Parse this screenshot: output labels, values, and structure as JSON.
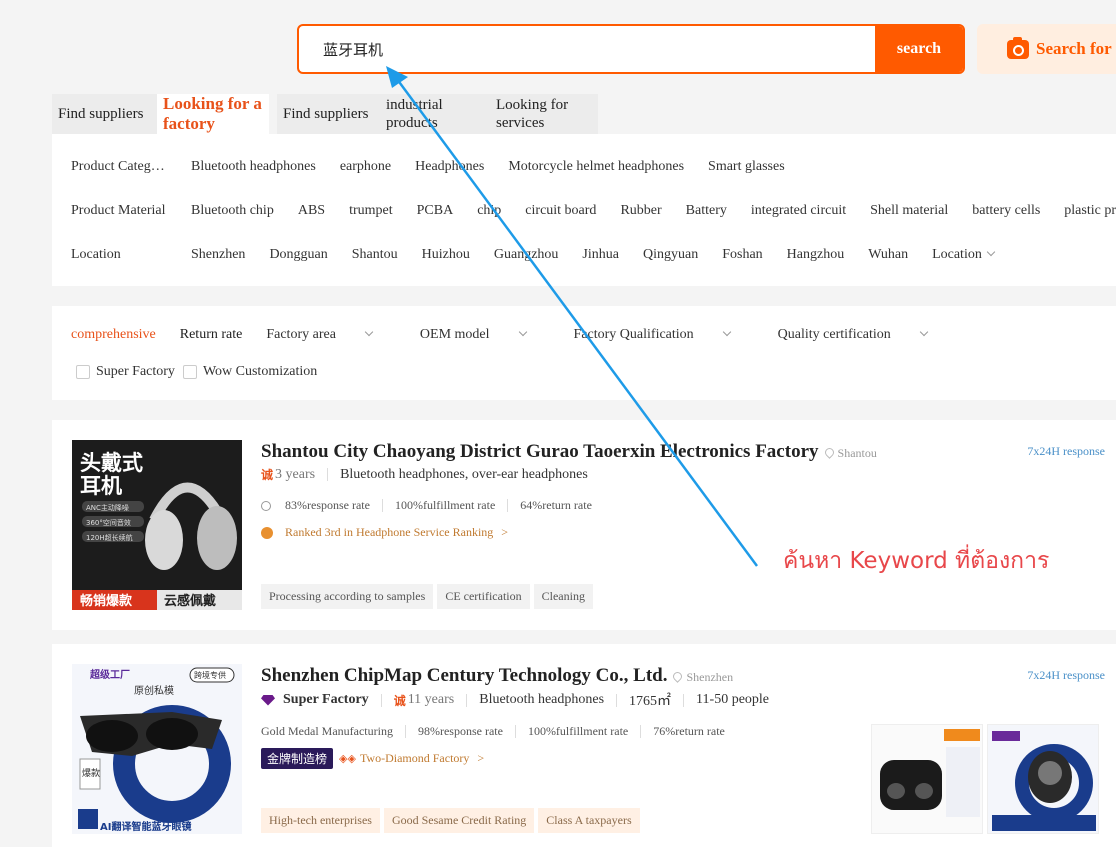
{
  "search": {
    "query": "蓝牙耳机",
    "button_label": "search",
    "image_search_label": "Search for"
  },
  "tabs": [
    {
      "label": "Find suppliers"
    },
    {
      "label": "Looking for a factory"
    },
    {
      "label": "Find suppliers"
    },
    {
      "label": "industrial products"
    },
    {
      "label": "Looking for services"
    }
  ],
  "filters": {
    "category": {
      "label": "Product Categ…",
      "options": [
        "Bluetooth headphones",
        "earphone",
        "Headphones",
        "Motorcycle helmet headphones",
        "Smart glasses"
      ]
    },
    "material": {
      "label": "Product Material",
      "options": [
        "Bluetooth chip",
        "ABS",
        "trumpet",
        "PCBA",
        "chip",
        "circuit board",
        "Rubber",
        "Battery",
        "integrated circuit",
        "Shell material",
        "battery cells",
        "plastic pr"
      ]
    },
    "location": {
      "label": "Location",
      "options": [
        "Shenzhen",
        "Dongguan",
        "Shantou",
        "Huizhou",
        "Guangzhou",
        "Jinhua",
        "Qingyuan",
        "Foshan",
        "Hangzhou",
        "Wuhan"
      ],
      "more": "Location"
    }
  },
  "sort": {
    "items": [
      "comprehensive",
      "Return rate",
      "Factory area",
      "OEM model",
      "Factory Qualification",
      "Quality certification"
    ],
    "checkboxes": [
      "Super Factory",
      "Wow Customization"
    ]
  },
  "suppliers": [
    {
      "name": "Shantou City Chaoyang District Gurao Taoerxin Electronics Factory",
      "location": "Shantou",
      "response": "7x24H response",
      "years_badge": "诚",
      "years": "3 years",
      "products": "Bluetooth headphones, over-ear headphones",
      "stats": [
        "83%response rate",
        "100%fulfillment rate",
        "64%return rate"
      ],
      "ranking": "Ranked 3rd in Headphone Service Ranking",
      "tags": [
        "Processing according to samples",
        "CE certification",
        "Cleaning"
      ],
      "thumb_text": {
        "title1": "头戴式",
        "title2": "耳机",
        "b1": "ANC主动降噪",
        "b2": "360°空间音效",
        "b3": "120H超长续航",
        "bottom1": "畅销爆款",
        "bottom2": "云感佩戴"
      }
    },
    {
      "name": "Shenzhen ChipMap Century Technology Co., Ltd.",
      "location": "Shenzhen",
      "response": "7x24H response",
      "super_factory": "Super Factory",
      "years_badge": "诚",
      "years": "11 years",
      "products": "Bluetooth headphones",
      "area": "1765㎡",
      "people": "11-50 people",
      "stats": [
        "Gold Medal Manufacturing",
        "98%response rate",
        "100%fulfillment rate",
        "76%return rate"
      ],
      "gold_badge": "金牌制造榜",
      "diamond_level": "Two-Diamond Factory",
      "tags": [
        "High-tech enterprises",
        "Good Sesame Credit Rating",
        "Class A taxpayers"
      ],
      "thumb_text": {
        "top": "超级工厂",
        "orig": "原创私模",
        "cross": "跨境专供",
        "hot": "爆款",
        "bottom": "AI翻译智能蓝牙眼镜"
      }
    }
  ],
  "annotation": "ค้นหา Keyword ที่ต้องการ",
  "colors": {
    "accent": "#ff5a00",
    "annotation": "#e8474a",
    "arrow": "#1e9be8"
  }
}
